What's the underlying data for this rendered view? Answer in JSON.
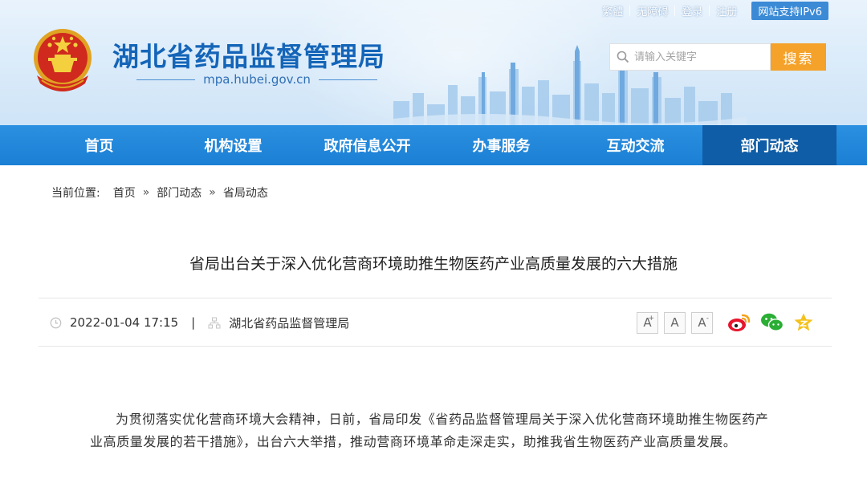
{
  "header": {
    "site_title": "湖北省药品监督管理局",
    "site_domain": "mpa.hubei.gov.cn",
    "top_links": [
      "繁體",
      "无障碍",
      "登录",
      "注册"
    ],
    "ipv6_badge": "网站支持IPv6",
    "search": {
      "placeholder": "请输入关键字",
      "button_label": "搜索"
    }
  },
  "nav": {
    "items": [
      "首页",
      "机构设置",
      "政府信息公开",
      "办事服务",
      "互动交流",
      "部门动态"
    ],
    "active_index": 5
  },
  "breadcrumb": {
    "label": "当前位置:",
    "items": [
      "首页",
      "部门动态",
      "省局动态"
    ],
    "separator": "»"
  },
  "article": {
    "title": "省局出台关于深入优化营商环境助推生物医药产业高质量发展的六大措施",
    "datetime": "2022-01-04 17:15",
    "meta_divider": "|",
    "source": "湖北省药品监督管理局",
    "font_size_buttons": [
      "A",
      "A",
      "A"
    ],
    "font_size_marks": [
      "+",
      "",
      "-"
    ],
    "share_icons": [
      "weibo-icon",
      "wechat-icon",
      "favorite-star-icon"
    ],
    "body": "为贯彻落实优化营商环境大会精神，日前，省局印发《省药品监督管理局关于深入优化营商环境助推生物医药产业高质量发展的若干措施》，出台六大举措，推动营商环境革命走深走实，助推我省生物医药产业高质量发展。"
  },
  "colors": {
    "nav_bg": "#1b7fd4",
    "nav_active": "#0f5da6",
    "title_blue": "#1465b8",
    "search_button": "#f5a22a"
  }
}
